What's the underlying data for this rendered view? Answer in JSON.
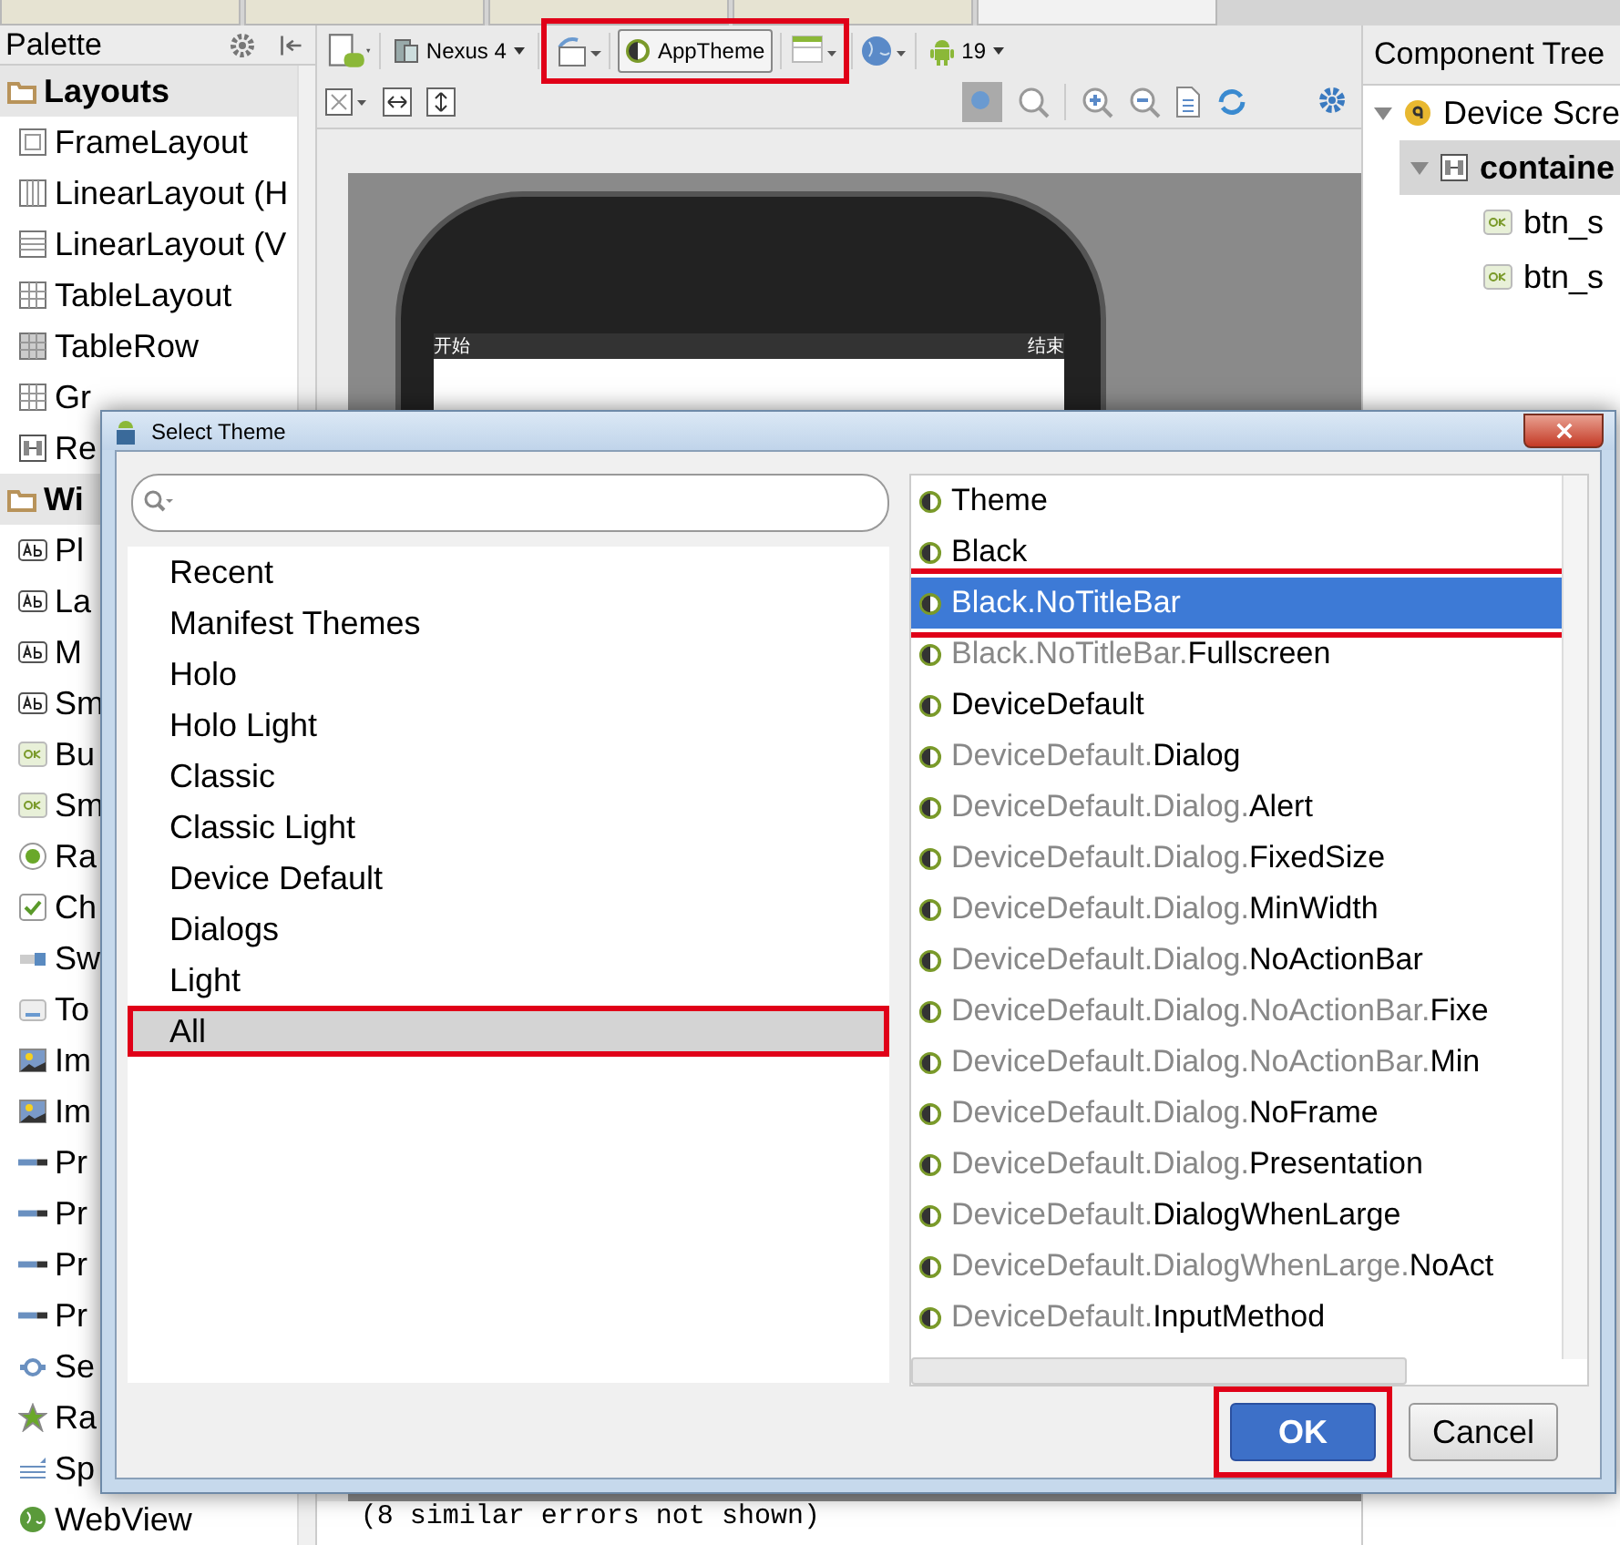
{
  "editor_tabs": [
    {
      "selected": false
    },
    {
      "selected": false
    },
    {
      "selected": false
    },
    {
      "selected": false
    },
    {
      "selected": true
    }
  ],
  "palette": {
    "title": "Palette",
    "items": [
      {
        "label": "Layouts",
        "kind": "header"
      },
      {
        "label": "FrameLayout",
        "kind": "frame"
      },
      {
        "label": "LinearLayout (H",
        "kind": "linear-h"
      },
      {
        "label": "LinearLayout (V",
        "kind": "linear-v"
      },
      {
        "label": "TableLayout",
        "kind": "table"
      },
      {
        "label": "TableRow",
        "kind": "tablerow"
      },
      {
        "label": "Gr",
        "kind": "table"
      },
      {
        "label": "Re",
        "kind": "relative"
      },
      {
        "label": "Wi",
        "kind": "header"
      },
      {
        "label": "Pl",
        "kind": "text"
      },
      {
        "label": "La",
        "kind": "text"
      },
      {
        "label": "M",
        "kind": "text"
      },
      {
        "label": "Sm",
        "kind": "text"
      },
      {
        "label": "Bu",
        "kind": "button"
      },
      {
        "label": "Sm",
        "kind": "button"
      },
      {
        "label": "Ra",
        "kind": "radio"
      },
      {
        "label": "Ch",
        "kind": "check"
      },
      {
        "label": "Sw",
        "kind": "switch"
      },
      {
        "label": "To",
        "kind": "toggle"
      },
      {
        "label": "Im",
        "kind": "image"
      },
      {
        "label": "Im",
        "kind": "image"
      },
      {
        "label": "Pr",
        "kind": "progress"
      },
      {
        "label": "Pr",
        "kind": "progress"
      },
      {
        "label": "Pr",
        "kind": "progress"
      },
      {
        "label": "Pr",
        "kind": "progress"
      },
      {
        "label": "Se",
        "kind": "seek"
      },
      {
        "label": "Ra",
        "kind": "rating"
      },
      {
        "label": "Sp",
        "kind": "spinner"
      },
      {
        "label": "WebView",
        "kind": "web"
      }
    ]
  },
  "toolbar": {
    "device": "Nexus 4",
    "theme": "AppTheme",
    "theme_highlighted": true,
    "api": "19"
  },
  "preview": {
    "left_text": "开始",
    "right_text": "结束",
    "message": "(8 similar errors not shown)"
  },
  "component_tree": {
    "title": "Component Tree",
    "items": [
      {
        "label": "Device Scre",
        "selected": false,
        "expanded": true,
        "kind": "device",
        "children": [
          {
            "label": "containe",
            "selected": true,
            "expanded": true,
            "kind": "relative",
            "children": [
              {
                "label": "btn_s",
                "selected": false,
                "kind": "button"
              },
              {
                "label": "btn_s",
                "selected": false,
                "kind": "button"
              }
            ]
          }
        ]
      }
    ]
  },
  "dialog": {
    "title": "Select Theme",
    "categories": [
      {
        "label": "Recent",
        "selected": false,
        "highlighted": false
      },
      {
        "label": "Manifest Themes",
        "selected": false,
        "highlighted": false
      },
      {
        "label": "Holo",
        "selected": false,
        "highlighted": false
      },
      {
        "label": "Holo Light",
        "selected": false,
        "highlighted": false
      },
      {
        "label": "Classic",
        "selected": false,
        "highlighted": false
      },
      {
        "label": "Classic Light",
        "selected": false,
        "highlighted": false
      },
      {
        "label": "Device Default",
        "selected": false,
        "highlighted": false
      },
      {
        "label": "Dialogs",
        "selected": false,
        "highlighted": false
      },
      {
        "label": "Light",
        "selected": false,
        "highlighted": false
      },
      {
        "label": "All",
        "selected": true,
        "highlighted": true
      }
    ],
    "themes": [
      {
        "name": "Theme",
        "selected": false,
        "highlighted": false
      },
      {
        "name": "Black",
        "selected": false,
        "highlighted": false
      },
      {
        "prefix": "Black.",
        "name": "NoTitleBar",
        "selected": true,
        "highlighted": true
      },
      {
        "prefix": "Black.NoTitleBar.",
        "name": "Fullscreen",
        "selected": false,
        "highlighted": false
      },
      {
        "name": "DeviceDefault",
        "selected": false,
        "highlighted": false
      },
      {
        "prefix": "DeviceDefault.",
        "name": "Dialog",
        "selected": false,
        "highlighted": false
      },
      {
        "prefix": "DeviceDefault.Dialog.",
        "name": "Alert",
        "selected": false,
        "highlighted": false
      },
      {
        "prefix": "DeviceDefault.Dialog.",
        "name": "FixedSize",
        "selected": false,
        "highlighted": false
      },
      {
        "prefix": "DeviceDefault.Dialog.",
        "name": "MinWidth",
        "selected": false,
        "highlighted": false
      },
      {
        "prefix": "DeviceDefault.Dialog.",
        "name": "NoActionBar",
        "selected": false,
        "highlighted": false
      },
      {
        "prefix": "DeviceDefault.Dialog.NoActionBar.",
        "name": "Fixe",
        "selected": false,
        "highlighted": false
      },
      {
        "prefix": "DeviceDefault.Dialog.NoActionBar.",
        "name": "Min",
        "selected": false,
        "highlighted": false
      },
      {
        "prefix": "DeviceDefault.Dialog.",
        "name": "NoFrame",
        "selected": false,
        "highlighted": false
      },
      {
        "prefix": "DeviceDefault.Dialog.",
        "name": "Presentation",
        "selected": false,
        "highlighted": false
      },
      {
        "prefix": "DeviceDefault.",
        "name": "DialogWhenLarge",
        "selected": false,
        "highlighted": false
      },
      {
        "prefix": "DeviceDefault.DialogWhenLarge.",
        "name": "NoAct",
        "selected": false,
        "highlighted": false
      },
      {
        "prefix": "DeviceDefault.",
        "name": "InputMethod",
        "selected": false,
        "highlighted": false
      }
    ],
    "buttons": [
      {
        "label": "OK",
        "kind": "primary",
        "highlighted": true
      },
      {
        "label": "Cancel",
        "kind": "secondary",
        "highlighted": false
      }
    ]
  }
}
